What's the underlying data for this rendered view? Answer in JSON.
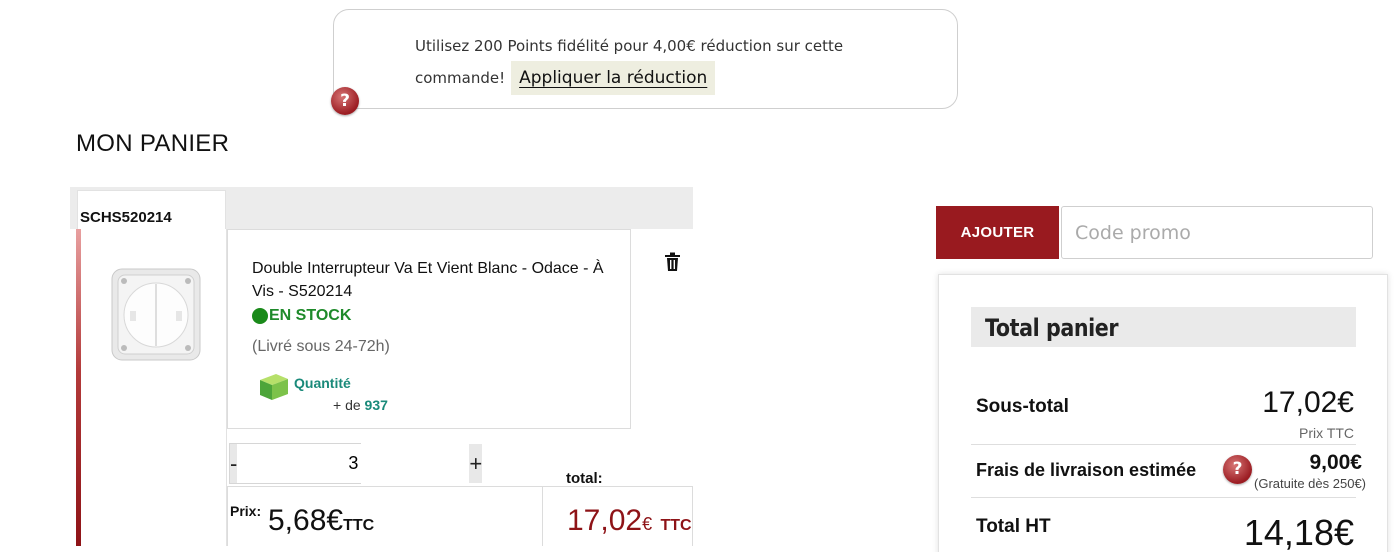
{
  "loyalty": {
    "message": "Utilisez 200 Points fidélité pour 4,00€ réduction sur cette commande!",
    "apply_label": "Appliquer la réduction"
  },
  "page_title": "MON PANIER",
  "cart": {
    "reference": "SCHS520214",
    "item": {
      "name": "Double Interrupteur Va Et Vient Blanc - Odace - À Vis - S520214",
      "stock": "EN STOCK",
      "delivery": "(Livré sous 24-72h)",
      "qty_label": "Quantité",
      "qty_prefix": "+ de",
      "qty_available": "937",
      "quantity": "3",
      "minus": "-",
      "plus": "+",
      "price_label": "Prix:",
      "unit_price": "5,68€",
      "ttc": "TTC",
      "total_label": "total:",
      "total_value": "17,02",
      "total_currency": "€",
      "total_ttc": "TTC"
    }
  },
  "promo": {
    "button_label": "AJOUTER",
    "placeholder": "Code promo"
  },
  "summary": {
    "title": "Total panier",
    "subtotal_label": "Sous-total",
    "subtotal_value": "17,02€",
    "subtotal_note": "Prix TTC",
    "shipping_label": "Frais de livraison estimée",
    "shipping_value": "9,00€",
    "shipping_note": "(Gratuite dès 250€)",
    "total_ht_label": "Total HT",
    "total_ht_value": "14,18€"
  },
  "icons": {
    "help": "question-icon",
    "trash": "trash-icon",
    "stock": "stock-dot-icon",
    "quantity": "box-icon"
  },
  "colors": {
    "brand": "#991a1f",
    "stock_green": "#1e8a2a",
    "qty_teal": "#1a8a7a"
  }
}
